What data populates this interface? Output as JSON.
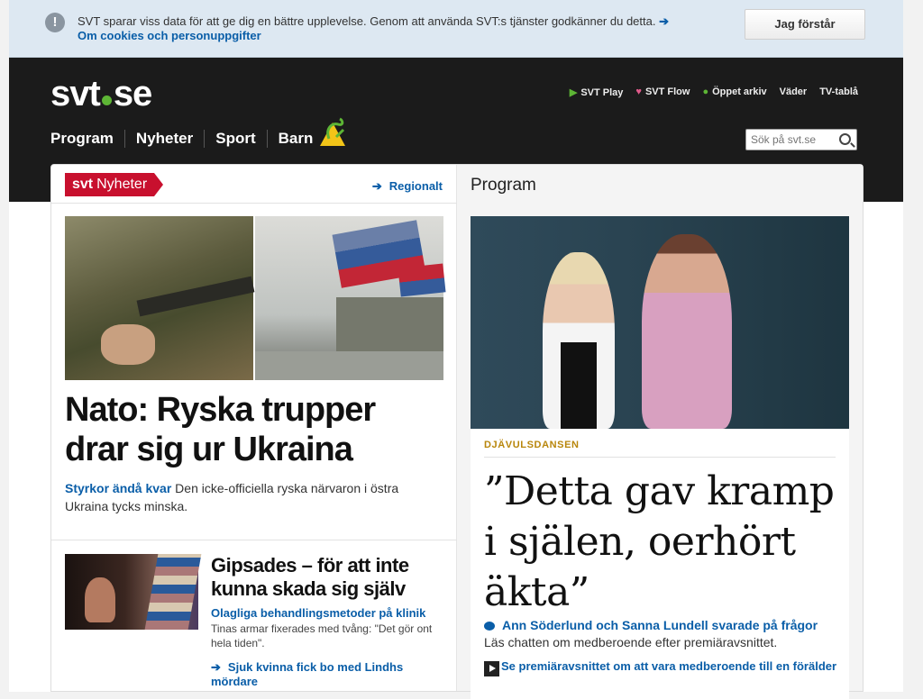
{
  "cookie": {
    "message": "SVT sparar viss data för att ge dig en bättre upplevelse. Genom att använda SVT:s tjänster godkänner du detta.",
    "link": "Om cookies och personuppgifter",
    "button": "Jag förstår"
  },
  "header": {
    "logo": {
      "prefix": "svt",
      "suffix": "se"
    },
    "toplinks": [
      "SVT Play",
      "SVT Flow",
      "Öppet arkiv",
      "Väder",
      "TV-tablå"
    ],
    "nav": [
      "Program",
      "Nyheter",
      "Sport",
      "Barn"
    ],
    "search_placeholder": "Sök på svt.se"
  },
  "news": {
    "brand": {
      "prefix": "svt",
      "name": "Nyheter"
    },
    "regional": "Regionalt",
    "main": {
      "headline": "Nato: Ryska trupper drar sig ur Ukraina",
      "kicker": "Styrkor ändå kvar",
      "text": " Den icke-officiella ryska närvaron i östra Ukraina tycks minska."
    },
    "second": {
      "headline": "Gipsades – för att inte kunna skada sig själv",
      "kicker": "Olagliga behandlingsmetoder på klinik",
      "text": "Tinas armar fixerades med tvång: \"Det gör ont hela tiden\".",
      "related": "Sjuk kvinna fick bo med Lindhs mördare"
    }
  },
  "program": {
    "title": "Program",
    "kicker": "DJÄVULSDANSEN",
    "quote": "”Detta gav kramp i själen, oerhört äkta”",
    "chat_link": "Ann Söderlund och Sanna Lundell svarade på frågor",
    "chat_text": "Läs chatten om medberoende efter premiäravsnittet.",
    "video_link": "Se premiäravsnittet om att vara medberoende till en förälder"
  },
  "colors": {
    "accent": "#0a5ea8",
    "brand_red": "#c8102e",
    "header_bg": "#1b1b1b",
    "kicker": "#b8860b"
  }
}
